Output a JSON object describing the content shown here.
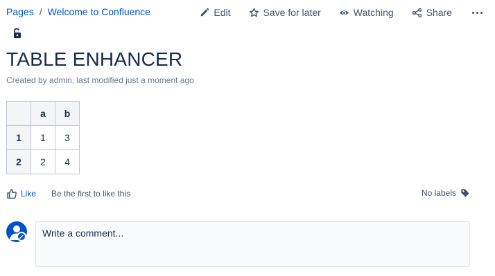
{
  "breadcrumb": {
    "root": "Pages",
    "separator": "/",
    "current": "Welcome to Confluence"
  },
  "toolbar": {
    "edit_label": "Edit",
    "save_label": "Save for later",
    "watch_label": "Watching",
    "share_label": "Share"
  },
  "page": {
    "title": "TABLE ENHANCER",
    "byline": "Created by admin, last modified just a moment ago"
  },
  "table": {
    "headers": [
      "",
      "a",
      "b"
    ],
    "rows": [
      [
        "1",
        "1",
        "3"
      ],
      [
        "2",
        "2",
        "4"
      ]
    ]
  },
  "footer": {
    "like_label": "Like",
    "like_hint": "Be the first to like this",
    "labels_text": "No labels"
  },
  "comment": {
    "placeholder": "Write a comment..."
  },
  "colors": {
    "link": "#0052cc",
    "text": "#172b4d",
    "muted": "#6b778c",
    "avatar": "#0052cc"
  },
  "icons": [
    "pencil-icon",
    "star-icon",
    "eye-icon",
    "share-icon",
    "more-icon",
    "unlock-icon",
    "thumbs-up-icon",
    "tag-icon",
    "user-avatar-icon"
  ]
}
